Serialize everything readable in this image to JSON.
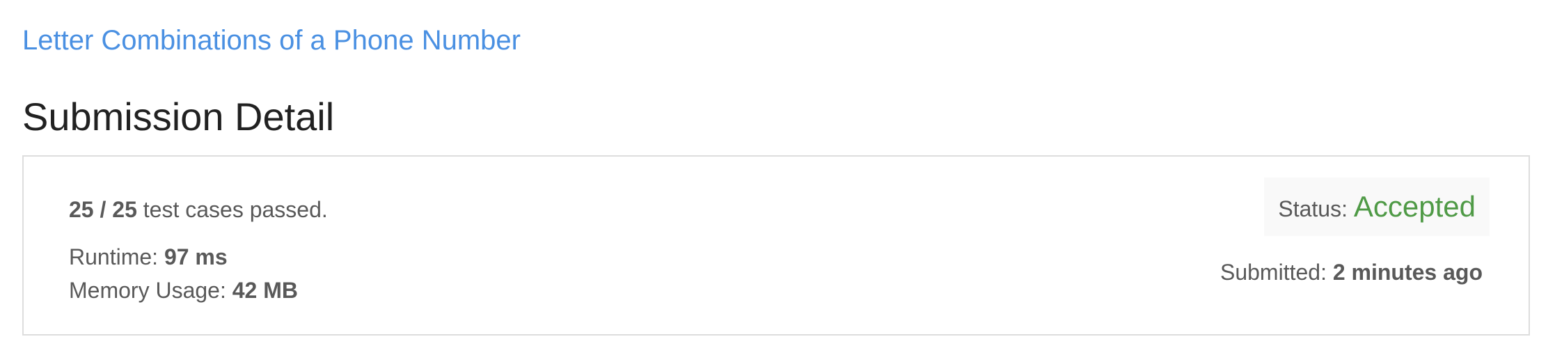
{
  "problem": {
    "title": "Letter Combinations of a Phone Number"
  },
  "page": {
    "title": "Submission Detail"
  },
  "result": {
    "passed": "25 / 25",
    "passed_suffix": " test cases passed.",
    "runtime_label": "Runtime: ",
    "runtime_value": "97 ms",
    "memory_label": "Memory Usage: ",
    "memory_value": "42 MB",
    "status_label": "Status: ",
    "status_value": "Accepted",
    "submitted_label": "Submitted: ",
    "submitted_value": "2 minutes ago"
  },
  "colors": {
    "link": "#4a90e2",
    "accepted": "#4f9a46",
    "title": "#212121",
    "text": "#595959",
    "panel_border": "#dddddd"
  }
}
